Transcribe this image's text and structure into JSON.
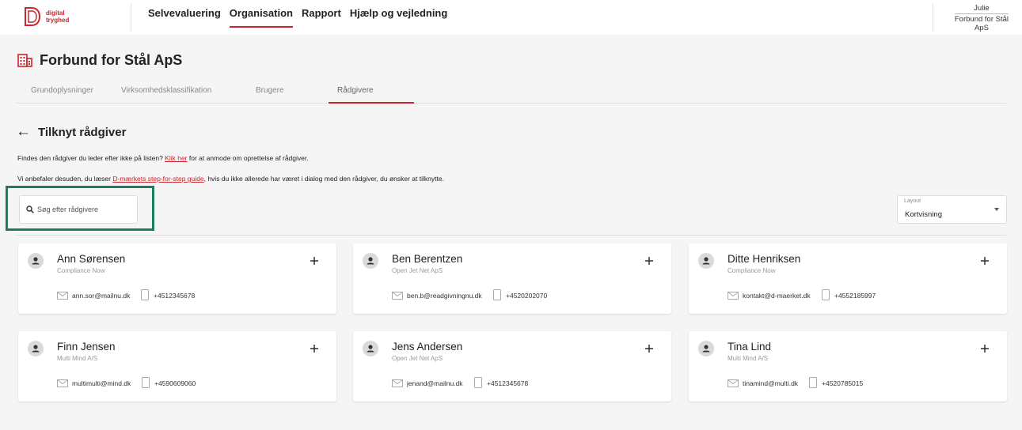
{
  "brand": {
    "logo_line1": "digital",
    "logo_line2": "tryghed",
    "accent": "#c8252c",
    "highlight": "#1f7a62"
  },
  "nav": [
    {
      "label": "Selvevaluering",
      "active": false
    },
    {
      "label": "Organisation",
      "active": true
    },
    {
      "label": "Rapport",
      "active": false
    },
    {
      "label": "Hjælp og vejledning",
      "active": false
    }
  ],
  "user": {
    "name": "Julie",
    "org_line1": "Forbund for Stål",
    "org_line2": "ApS"
  },
  "page": {
    "title": "Forbund for Stål ApS",
    "icon": "building-icon"
  },
  "tabs": [
    {
      "label": "Grundoplysninger",
      "active": false
    },
    {
      "label": "Virksomhedsklassifikation",
      "active": false
    },
    {
      "label": "Brugere",
      "active": false
    },
    {
      "label": "Rådgivere",
      "active": true
    }
  ],
  "section": {
    "title": "Tilknyt rådgiver",
    "icon": "arrow-left-icon"
  },
  "info1": {
    "before": "Findes den rådgiver du leder efter ikke på listen? ",
    "link": "Klik her",
    "after": " for at anmode om oprettelse af rådgiver."
  },
  "info2": {
    "before": "Vi anbefaler desuden, du læser ",
    "link": "D-mærkets step-for-step guide",
    "after": ", hvis du ikke allerede har været i dialog med den rådgiver, du ønsker at tilknytte."
  },
  "search": {
    "placeholder": "Søg efter rådgivere",
    "value": ""
  },
  "layout": {
    "label": "Layout",
    "value": "Kortvisning"
  },
  "advisors": [
    {
      "name": "Ann Sørensen",
      "company": "Compliance Now",
      "email": "ann.sor@mailnu.dk",
      "phone": "+4512345678"
    },
    {
      "name": "Ben Berentzen",
      "company": "Open Jet Net ApS",
      "email": "ben.b@readgivningnu.dk",
      "phone": "+4520202070"
    },
    {
      "name": "Ditte Henriksen",
      "company": "Compliance Now",
      "email": "kontakt@d-maerket.dk",
      "phone": "+4552185997"
    },
    {
      "name": "Finn Jensen",
      "company": "Multi Mind A/S",
      "email": "multimulti@mind.dk",
      "phone": "+4590609060"
    },
    {
      "name": "Jens Andersen",
      "company": "Open Jet Net ApS",
      "email": "jenand@mailnu.dk",
      "phone": "+4512345678"
    },
    {
      "name": "Tina Lind",
      "company": "Multi Mind A/S",
      "email": "tinamind@multi.dk",
      "phone": "+4520785015"
    }
  ]
}
